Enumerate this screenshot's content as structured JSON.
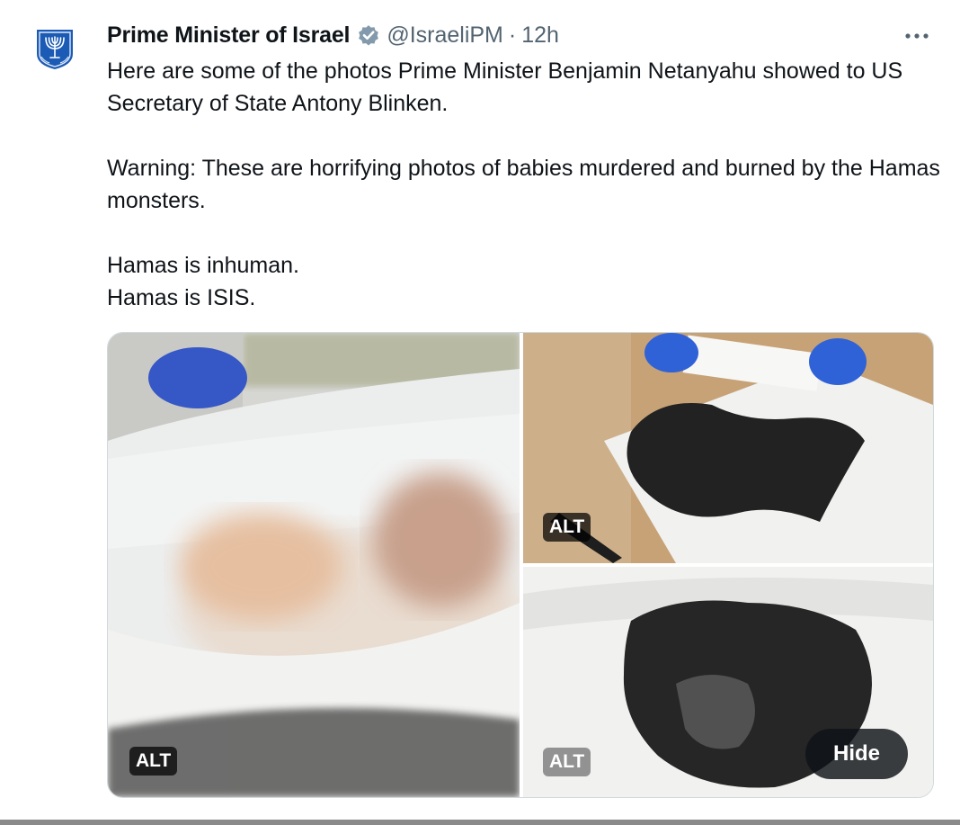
{
  "author": {
    "display_name": "Prime Minister of Israel",
    "handle": "@IsraeliPM",
    "separator": "·",
    "time": "12h",
    "verified_icon": "gray-verified-badge-icon",
    "avatar_icon": "menorah-emblem-icon"
  },
  "more_icon": "more-options-icon",
  "tweet": {
    "paragraphs": [
      "Here are some of the photos Prime Minister Benjamin Netanyahu showed to US Secretary of State Antony Blinken.",
      "Warning: These are horrifying photos of babies murdered and burned by the Hamas monsters.",
      "Hamas is inhuman.",
      "Hamas is ISIS."
    ]
  },
  "media": {
    "photos": [
      {
        "alt_label": "ALT",
        "description": "blurred-photo-white-plastic-sheet"
      },
      {
        "alt_label": "ALT",
        "description": "photo-charred-remains-gloved-hands"
      },
      {
        "alt_label": "ALT",
        "description": "photo-charred-remains-white-sheet"
      }
    ],
    "hide_label": "Hide"
  },
  "colors": {
    "text": "#0f1419",
    "secondary": "#536471",
    "emblem_blue": "#1c5bb5"
  }
}
